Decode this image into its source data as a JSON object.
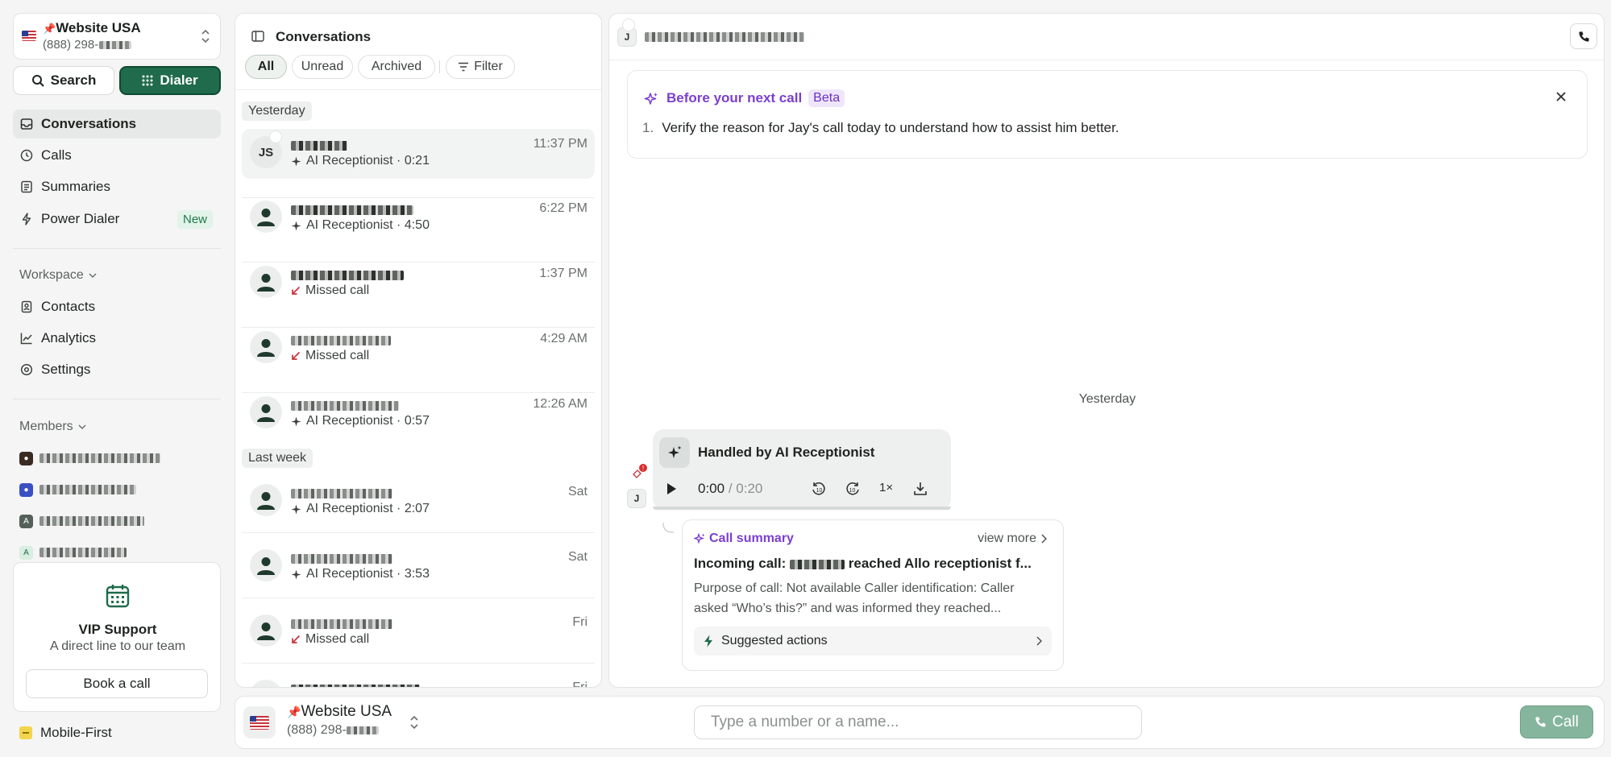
{
  "colors": {
    "brand_green": "#1f6b4b",
    "ai_purple": "#7b3fd1",
    "missed_red": "#c8323b",
    "new_badge_bg": "#e2f3e9"
  },
  "number_selector": {
    "pin": "📌",
    "title": "Website USA",
    "number": "(888) 298-"
  },
  "sidebar": {
    "search_label": "Search",
    "dialer_label": "Dialer",
    "nav": [
      {
        "label": "Conversations",
        "icon": "inbox-icon"
      },
      {
        "label": "Calls",
        "icon": "clock-icon"
      },
      {
        "label": "Summaries",
        "icon": "document-icon"
      },
      {
        "label": "Power Dialer",
        "icon": "bolt-icon",
        "badge": "New"
      }
    ],
    "workspace_label": "Workspace",
    "workspace_nav": [
      {
        "label": "Contacts",
        "icon": "contacts-icon"
      },
      {
        "label": "Analytics",
        "icon": "chart-icon"
      },
      {
        "label": "Settings",
        "icon": "gear-icon"
      }
    ],
    "members_label": "Members",
    "members": [
      {
        "avatar": "photo"
      },
      {
        "avatar": "photo"
      },
      {
        "avatar": "A"
      },
      {
        "avatar": "A"
      }
    ],
    "vip": {
      "title": "VIP Support",
      "subtitle": "A direct line to our team",
      "button": "Book a call"
    },
    "mobile_first": "Mobile-First"
  },
  "conversations": {
    "title": "Conversations",
    "filters": [
      "All",
      "Unread",
      "Archived"
    ],
    "filter_button": "Filter",
    "groups": [
      {
        "label": "Yesterday",
        "items": [
          {
            "initials": "JS",
            "sub": "AI Receptionist · 0:21",
            "type": "ai",
            "time": "11:37 PM"
          },
          {
            "sub": "AI Receptionist · 4:50",
            "type": "ai",
            "time": "6:22 PM"
          },
          {
            "sub": "Missed call",
            "type": "missed",
            "time": "1:37 PM"
          },
          {
            "sub": "Missed call",
            "type": "missed",
            "time": "4:29 AM"
          },
          {
            "sub": "AI Receptionist · 0:57",
            "type": "ai",
            "time": "12:26 AM"
          }
        ]
      },
      {
        "label": "Last week",
        "items": [
          {
            "sub": "AI Receptionist · 2:07",
            "type": "ai",
            "time": "Sat"
          },
          {
            "sub": "AI Receptionist · 3:53",
            "type": "ai",
            "time": "Sat"
          },
          {
            "sub": "Missed call",
            "type": "missed",
            "time": "Fri"
          },
          {
            "sub": "",
            "type": "ai",
            "time": "Fri"
          }
        ]
      }
    ]
  },
  "main": {
    "contact_badge": "J",
    "before_call": {
      "title": "Before your next call",
      "badge": "Beta",
      "items": [
        "Verify the reason for Jay's call today to understand how to assist him better."
      ]
    },
    "day_divider": "Yesterday",
    "call": {
      "title": "Handled by AI Receptionist",
      "current": "0:00",
      "sep": "/",
      "duration": "0:20",
      "speed": "1×",
      "sender_badge": "J"
    },
    "summary": {
      "label": "Call summary",
      "view_more": "view more",
      "title_pre": "Incoming call:",
      "title_post": "reached Allo receptionist f...",
      "body": "Purpose of call: Not available Caller identification: Caller asked “Who’s this?” and was informed they reached...",
      "actions": "Suggested actions"
    }
  },
  "bottom": {
    "pin": "📌",
    "title": "Website USA",
    "number": "(888) 298-",
    "input_placeholder": "Type a number or a name...",
    "call_label": "Call"
  }
}
